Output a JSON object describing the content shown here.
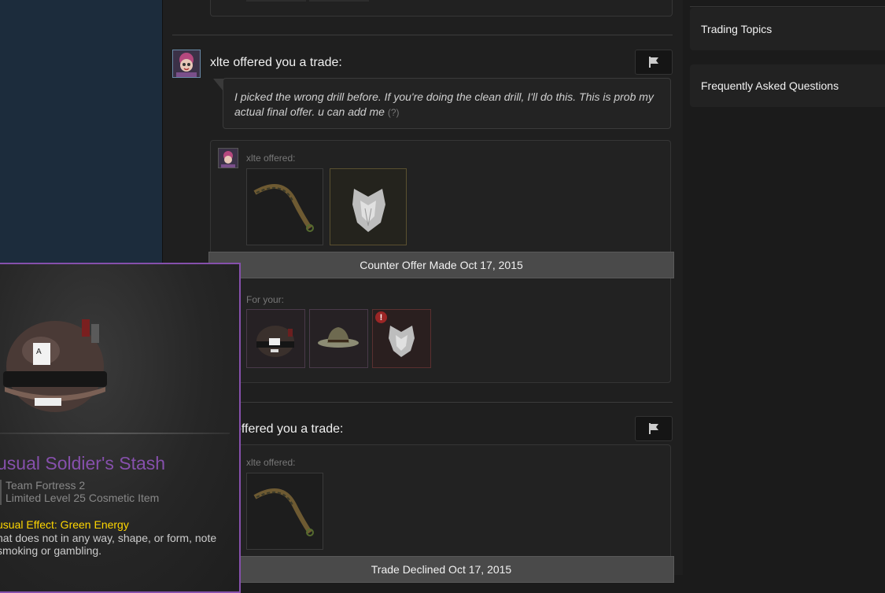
{
  "trades": [
    {
      "title": "xlte offered you a trade:",
      "message": "I picked the wrong drill before. If you're doing the clean drill, I'll do this. This is prob my actual final offer. u can add me",
      "help_marker": "(?)",
      "offered_label": "xlte offered:",
      "offered_items": [
        "Drill item",
        "Beard item"
      ],
      "status": "Counter Offer Made Oct 17, 2015",
      "for_label": "For your:",
      "for_items": [
        "Soldier's Stash",
        "Campaign hat",
        "Beard item"
      ]
    },
    {
      "title": "offered you a trade:",
      "offered_label": "xlte offered:",
      "offered_items": [
        "Drill item"
      ],
      "status": "Trade Declined Oct 17, 2015"
    }
  ],
  "sidebar": {
    "items": [
      {
        "label": "Trading Topics"
      },
      {
        "label": "Frequently Asked Questions"
      }
    ]
  },
  "tooltip": {
    "name": "usual Soldier's Stash",
    "game": "Team Fortress 2",
    "type": "Limited Level 25 Cosmetic Item",
    "effect": "usual Effect: Green Energy",
    "description": "hat does not in any way, shape, or form, note smoking or gambling."
  },
  "colors": {
    "unusual": "#8650ac",
    "unique": "#5a5030",
    "strange": "#5a3030",
    "effect": "#ffd700",
    "status_bar": "#4a4a4a"
  },
  "icons": {
    "flag": "flag-icon",
    "alert": "exclamation-icon"
  }
}
